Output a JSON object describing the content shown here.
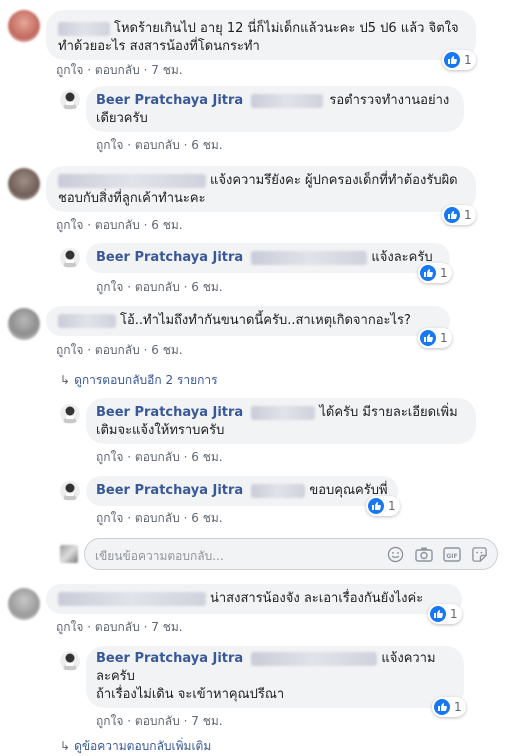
{
  "comments": [
    {
      "text": "โหดร้ายเกินไป อายุ 12 นี่ก็ไม่เด็กแล้วนะคะ ป5 ป6 แล้ว จิตใจทำด้วยอะไร สงสารน้องที่โดนกระทำ",
      "time": "7 ชม.",
      "likes": "1"
    },
    {
      "name": "Beer Pratchaya Jitra",
      "text": "รอตำรวจทำงานอย่างเดียวครับ",
      "time": "6 ชม."
    },
    {
      "text": "แจ้งความรึยังคะ ผู้ปกครองเด็กที่ทำต้องรับผิดชอบกับสิ่งที่ลูกเค้าทำนะคะ",
      "time": "6 ชม.",
      "likes": "1"
    },
    {
      "name": "Beer Pratchaya Jitra",
      "text": "แจ้งละครับ",
      "time": "6 ชม.",
      "likes": "1"
    },
    {
      "text": "โอ้..ทำไมถึงทำกันขนาดนี้ครับ..สาเหตุเกิดจากอะไร?",
      "time": "6 ชม.",
      "likes": "1"
    },
    {
      "name": "Beer Pratchaya Jitra",
      "text": "ได้ครับ มีรายละเอียดเพิ่มเติมจะแจ้งให้ทราบครับ",
      "time": "6 ชม.",
      "likes": "1"
    },
    {
      "name": "Beer Pratchaya Jitra",
      "text": "ขอบคุณครับพี่",
      "time": "6 ชม.",
      "likes": "1"
    },
    {
      "text": "น่าสงสารน้องจัง ละเอาเรื่องกันยังไงค่ะ",
      "time": "7 ชม.",
      "likes": "1"
    },
    {
      "name": "Beer Pratchaya Jitra",
      "text_line1": "แจ้งความ",
      "text_line2": "ละครับ",
      "text_line3": "ถ้าเรื่องไม่เดิน จะเข้าหาคุณปรีณา",
      "time": "7 ชม.",
      "likes": "1"
    }
  ],
  "actions": {
    "like": "ถูกใจ",
    "reply": "ตอบกลับ",
    "sep": "·"
  },
  "view_replies": "ดูการตอบกลับอีก 2 รายการ",
  "more_replies": "ดูข้อความตอบกลับเพิ่มเติม",
  "reply_placeholder": "เขียนข้อความตอบกลับ...",
  "input_icons": [
    "emoji-icon",
    "camera-icon",
    "gif-icon",
    "sticker-icon"
  ],
  "colors": {
    "link": "#385898",
    "bubble": "#f2f3f5",
    "like": "#1877f2",
    "meta": "#606770"
  }
}
